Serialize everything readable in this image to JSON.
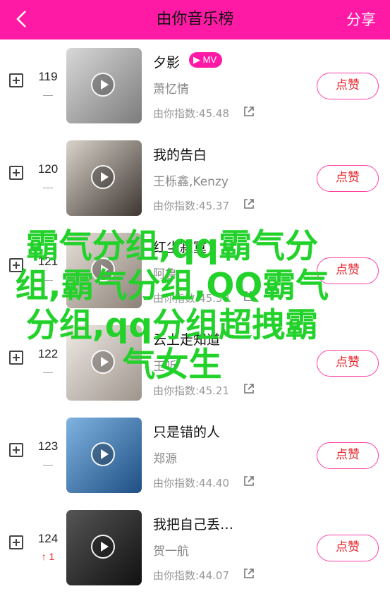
{
  "header": {
    "title": "由你音乐榜",
    "share_label": "分享"
  },
  "mv_badge": "▶ MV",
  "like_label": "点赞",
  "songs": [
    {
      "rank": "119",
      "trend": "—",
      "title": "夕影",
      "artist": "萧忆情",
      "index": "由你指数:45.48",
      "cover": "#a8a8a8"
    },
    {
      "rank": "120",
      "trend": "—",
      "title": "我的告白",
      "artist": "王栎鑫,Kenzy",
      "index": "由你指数:45.37",
      "cover": "#6b5f55"
    },
    {
      "rank": "121",
      "trend": "—",
      "title": "红尘寂寞",
      "artist": "阿鲁",
      "index": "由你指数:45.30",
      "cover": "#c7c0b8"
    },
    {
      "rank": "122",
      "trend": "—",
      "title": "云上走知道",
      "artist": "王听",
      "index": "由你指数:45.21",
      "cover": "#d9d2cc"
    },
    {
      "rank": "123",
      "trend": "—",
      "title": "只是错的人",
      "artist": "郑源",
      "index": "由你指数:44.40",
      "cover": "#2f6fb3"
    },
    {
      "rank": "124",
      "trend": "↑ 1",
      "title": "我把自己丢…",
      "artist": "贺一航",
      "index": "由你指数:44.07",
      "cover": "#2a2a2a"
    }
  ],
  "overlay_text": "霸气分组,qq霸气分组,霸气分组,QQ霸气分组,qq分组超拽霸气女生"
}
